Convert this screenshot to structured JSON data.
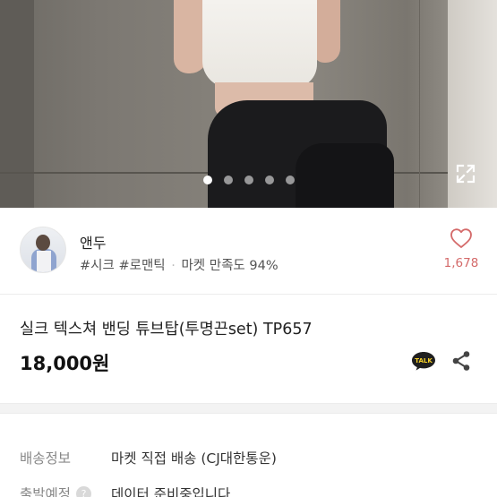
{
  "gallery": {
    "page_count": 5,
    "active_index": 0
  },
  "seller": {
    "name": "앤두",
    "tag1": "#시크",
    "tag2": "#로맨틱",
    "separator": "·",
    "satisfaction": "마켓 만족도 94%"
  },
  "likes": {
    "count": "1,678",
    "color": "#d46a6a"
  },
  "product": {
    "title": "실크 텍스쳐 밴딩 튜브탑(투명끈set) TP657",
    "price": "18,000원",
    "talk_label": "TALK"
  },
  "info": [
    {
      "label": "배송정보",
      "value": "마켓 직접 배송 (CJ대한통운)"
    },
    {
      "label": "출발예정",
      "help": "?",
      "value": "데이터 준비중입니다"
    }
  ],
  "icons": {
    "expand": "expand-icon",
    "heart": "heart-outline-icon",
    "talk": "kakao-talk-icon",
    "share": "share-icon"
  }
}
